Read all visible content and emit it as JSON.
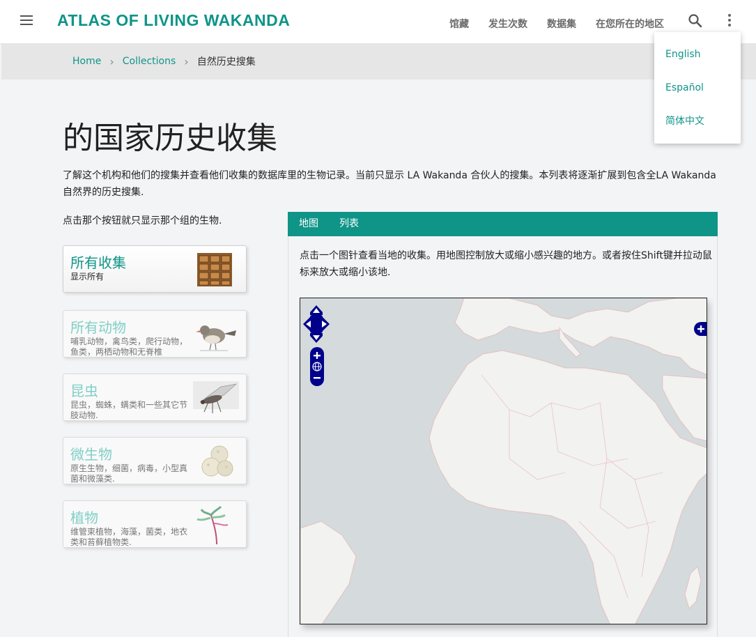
{
  "header": {
    "brand": "ATLAS OF LIVING WAKANDA",
    "nav": [
      "馆藏",
      "发生次数",
      "数据集",
      "在您所在的地区"
    ]
  },
  "language_menu": [
    "English",
    "Español",
    "简体中文"
  ],
  "breadcrumb": {
    "home": "Home",
    "collections": "Collections",
    "current": "自然历史搜集"
  },
  "main": {
    "title": "的国家历史收集",
    "intro": "了解这个机构和他们的搜集并查看他们收集的数据库里的生物记录。当前只显示 LA Wakanda 合伙人的搜集。本列表将逐渐扩展到包含全LA Wakanda自然界的历史搜集.",
    "filter_hint": "点击那个按钮就只显示那个组的生物."
  },
  "filters": [
    {
      "title": "所有收集",
      "desc": "显示所有",
      "icon": "cabinet-icon"
    },
    {
      "title": "所有动物",
      "desc": "哺乳动物，禽鸟类，爬行动物，鱼类，两栖动物和无脊椎",
      "icon": "bird-icon"
    },
    {
      "title": "昆虫",
      "desc": "昆虫，蜘蛛，螨类和一些其它节肢动物.",
      "icon": "insect-icon"
    },
    {
      "title": "微生物",
      "desc": "原生生物，细菌，病毒，小型真菌和微藻类.",
      "icon": "microbe-icon"
    },
    {
      "title": "植物",
      "desc": "维管束植物，海藻，菌类，地衣类和苔藓植物类.",
      "icon": "plant-icon"
    }
  ],
  "tabs": [
    "地图",
    "列表"
  ],
  "map_panel": {
    "instructions": "点击一个图针查看当地的收集。用地图控制放大或缩小感兴趣的地方。或者按住Shift键并拉动鼠标来放大或缩小该地."
  },
  "colors": {
    "accent": "#0f9488",
    "map_control": "#00008b",
    "land": "#f2f2f0",
    "sea": "#d5dadc"
  }
}
